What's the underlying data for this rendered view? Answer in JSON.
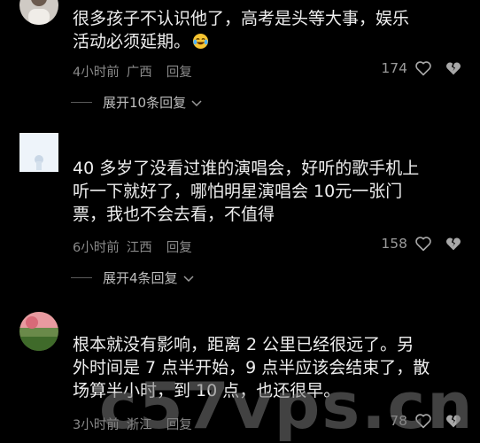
{
  "comments": [
    {
      "text": "很多孩子不认识他了，高考是头等大事，娱乐\n活动必须延期。",
      "emoji": "laughing-crying-emoji",
      "time": "4小时前",
      "location": "广西",
      "reply_label": "回复",
      "likes": "174",
      "expand_label": "展开10条回复"
    },
    {
      "text": "40 多岁了没看过谁的演唱会，好听的歌手机上\n听一下就好了，哪怕明星演唱会 10元一张门\n票，我也不会去看，不值得",
      "time": "6小时前",
      "location": "江西",
      "reply_label": "回复",
      "likes": "158",
      "expand_label": "展开4条回复"
    },
    {
      "text": "根本就没有影响，距离 2 公里已经很远了。另\n外时间是 7 点半开始，9 点半应该会结束了，散\n场算半小时，到 10 点，也还很早。",
      "time": "3小时前",
      "location": "浙江",
      "reply_label": "回复",
      "likes": "78"
    }
  ],
  "watermark": "c57vps.cn",
  "icons": {
    "like": "heart-icon",
    "dislike": "broken-heart-icon",
    "expand": "chevron-down-icon"
  },
  "colors": {
    "background": "#000000",
    "text": "#eeeeee",
    "meta": "#8a8a8a"
  }
}
